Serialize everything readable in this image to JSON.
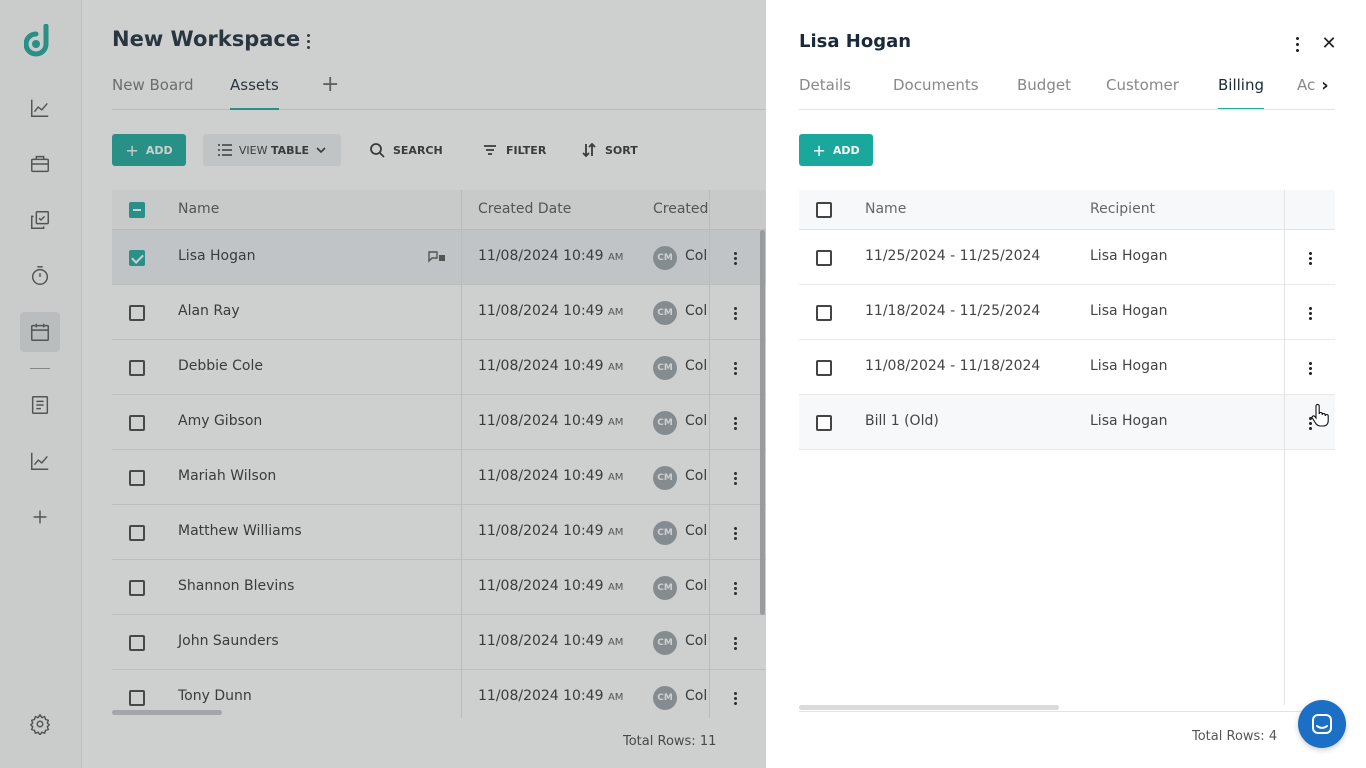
{
  "workspace": {
    "title": "New Workspace",
    "tabs": [
      {
        "label": "New Board",
        "active": false
      },
      {
        "label": "Assets",
        "active": true
      }
    ]
  },
  "toolbar": {
    "add_label": "ADD",
    "view_label_pre": "VIEW ",
    "view_label_bold": "TABLE",
    "search_label": "SEARCH",
    "filter_label": "FILTER",
    "sort_label": "SORT"
  },
  "grid": {
    "columns": [
      "Name",
      "Created Date",
      "Created"
    ],
    "rows": [
      {
        "name": "Lisa Hogan",
        "date": "11/08/2024 10:49",
        "ampm": "AM",
        "initials": "CM",
        "created_by": "Col",
        "checked": true
      },
      {
        "name": "Alan Ray",
        "date": "11/08/2024 10:49",
        "ampm": "AM",
        "initials": "CM",
        "created_by": "Col",
        "checked": false
      },
      {
        "name": "Debbie Cole",
        "date": "11/08/2024 10:49",
        "ampm": "AM",
        "initials": "CM",
        "created_by": "Col",
        "checked": false
      },
      {
        "name": "Amy Gibson",
        "date": "11/08/2024 10:49",
        "ampm": "AM",
        "initials": "CM",
        "created_by": "Col",
        "checked": false
      },
      {
        "name": "Mariah Wilson",
        "date": "11/08/2024 10:49",
        "ampm": "AM",
        "initials": "CM",
        "created_by": "Col",
        "checked": false
      },
      {
        "name": "Matthew Williams",
        "date": "11/08/2024 10:49",
        "ampm": "AM",
        "initials": "CM",
        "created_by": "Col",
        "checked": false
      },
      {
        "name": "Shannon Blevins",
        "date": "11/08/2024 10:49",
        "ampm": "AM",
        "initials": "CM",
        "created_by": "Col",
        "checked": false
      },
      {
        "name": "John Saunders",
        "date": "11/08/2024 10:49",
        "ampm": "AM",
        "initials": "CM",
        "created_by": "Col",
        "checked": false
      },
      {
        "name": "Tony Dunn",
        "date": "11/08/2024 10:49",
        "ampm": "AM",
        "initials": "CM",
        "created_by": "Col",
        "checked": false
      }
    ],
    "total_rows": "Total Rows: 11"
  },
  "panel": {
    "title": "Lisa Hogan",
    "tabs": [
      {
        "label": "Details",
        "active": false
      },
      {
        "label": "Documents",
        "active": false
      },
      {
        "label": "Budget",
        "active": false
      },
      {
        "label": "Customer",
        "active": false
      },
      {
        "label": "Billing",
        "active": true
      },
      {
        "label": "Ac",
        "active": false
      }
    ],
    "add_label": "ADD",
    "columns": [
      "Name",
      "Recipient"
    ],
    "rows": [
      {
        "name": "11/25/2024 - 11/25/2024",
        "recipient": "Lisa Hogan"
      },
      {
        "name": "11/18/2024 - 11/25/2024",
        "recipient": "Lisa Hogan"
      },
      {
        "name": "11/08/2024 - 11/18/2024",
        "recipient": "Lisa Hogan"
      },
      {
        "name": "Bill 1 (Old)",
        "recipient": "Lisa Hogan"
      }
    ],
    "total_rows": "Total Rows: 4"
  },
  "colors": {
    "accent": "#1aa89c",
    "chat": "#1b6fc4"
  },
  "icons": {
    "sidebar": [
      "analytics-icon",
      "briefcase-icon",
      "copy-check-icon",
      "stopwatch-icon",
      "calendar-icon",
      "document-icon",
      "chart-icon",
      "plus-icon",
      "settings-icon"
    ]
  }
}
